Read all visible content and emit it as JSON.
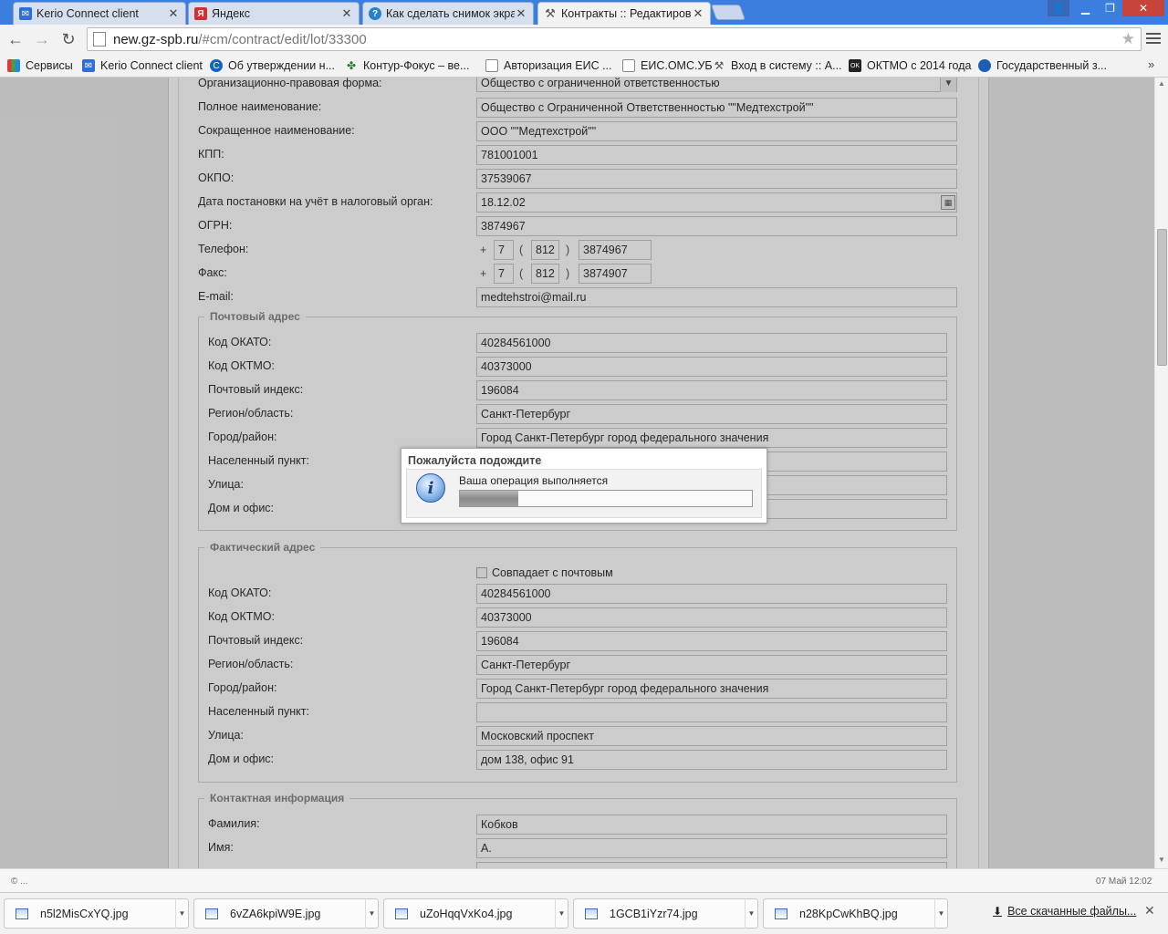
{
  "tabs": [
    {
      "title": "Kerio Connect client",
      "icon": "mail-icon",
      "color": "#2f6fd1"
    },
    {
      "title": "Яндекс",
      "icon": "yandex-icon",
      "color": "#d32f2f"
    },
    {
      "title": "Как сделать снимок экра",
      "icon": "help-icon",
      "color": "#2a7fc9"
    },
    {
      "title": "Контракты :: Редактиров",
      "icon": "hammer-icon",
      "color": "#555555"
    }
  ],
  "address": {
    "host": "new.gz-spb.ru",
    "path": "/#cm/contract/edit/lot/33300"
  },
  "bookmarks": [
    "Сервисы",
    "Kerio Connect client",
    "Об утверждении н...",
    "Контур-Фокус – ве...",
    "Авторизация ЕИС ...",
    "ЕИС.ОМС.УБ",
    "Вход в систему :: А...",
    "ОКТМО с 2014 года",
    "Государственный з..."
  ],
  "bookmarks_more": "»",
  "org": {
    "fields": [
      {
        "label": "Организационно-правовая форма:",
        "value": "Общество с ограниченной ответственностью"
      },
      {
        "label": "Полное наименование:",
        "value": "Общество с Ограниченной Ответственностью \"\"Медтехстрой\"\""
      },
      {
        "label": "Сокращенное наименование:",
        "value": "ООО \"\"Медтехстрой\"\""
      },
      {
        "label": "КПП:",
        "value": "781001001"
      },
      {
        "label": "ОКПО:",
        "value": "37539067"
      },
      {
        "label": "Дата постановки на учёт в налоговый орган:",
        "value": "18.12.02"
      },
      {
        "label": "ОГРН:",
        "value": "3874967"
      }
    ],
    "phone": {
      "label": "Телефон:",
      "plus": "+",
      "country": "7",
      "code": "812",
      "number": "3874967",
      "open": "(",
      "close": ")"
    },
    "fax": {
      "label": "Факс:",
      "plus": "+",
      "country": "7",
      "code": "812",
      "number": "3874907",
      "open": "(",
      "close": ")"
    },
    "email": {
      "label": "E-mail:",
      "value": "medtehstroi@mail.ru"
    }
  },
  "postal": {
    "legend": "Почтовый адрес",
    "fields": [
      {
        "label": "Код ОКАТО:",
        "value": "40284561000"
      },
      {
        "label": "Код ОКТМО:",
        "value": "40373000"
      },
      {
        "label": "Почтовый индекс:",
        "value": "196084"
      },
      {
        "label": "Регион/область:",
        "value": "Санкт-Петербург"
      },
      {
        "label": "Город/район:",
        "value": "Город Санкт-Петербург город федерального значения"
      },
      {
        "label": "Населенный пункт:",
        "value": ""
      },
      {
        "label": "Улица:",
        "value": ""
      },
      {
        "label": "Дом и офис:",
        "value": ""
      }
    ]
  },
  "actual": {
    "legend": "Фактический адрес",
    "same_label": "Совпадает с почтовым",
    "fields": [
      {
        "label": "Код ОКАТО:",
        "value": "40284561000"
      },
      {
        "label": "Код ОКТМО:",
        "value": "40373000"
      },
      {
        "label": "Почтовый индекс:",
        "value": "196084"
      },
      {
        "label": "Регион/область:",
        "value": "Санкт-Петербург"
      },
      {
        "label": "Город/район:",
        "value": "Город Санкт-Петербург город федерального значения"
      },
      {
        "label": "Населенный пункт:",
        "value": ""
      },
      {
        "label": "Улица:",
        "value": "Московский проспект"
      },
      {
        "label": "Дом и офис:",
        "value": "дом 138, офис 91"
      }
    ]
  },
  "contact": {
    "legend": "Контактная информация",
    "fields": [
      {
        "label": "Фамилия:",
        "value": "Кобков"
      },
      {
        "label": "Имя:",
        "value": "А."
      },
      {
        "label": "",
        "value": ""
      }
    ]
  },
  "modal": {
    "title": "Пожалуйста подождите",
    "message": "Ваша операция выполняется",
    "progress": 0.2
  },
  "status": {
    "left": "© ...",
    "right": "07 Май 12:02"
  },
  "downloads": {
    "files": [
      "n5l2MisCxYQ.jpg",
      "6vZA6kpiW9E.jpg",
      "uZoHqqVxKo4.jpg",
      "1GCB1iYzr74.jpg",
      "n28KpCwKhBQ.jpg"
    ],
    "all_label": "Все скачанные файлы..."
  }
}
